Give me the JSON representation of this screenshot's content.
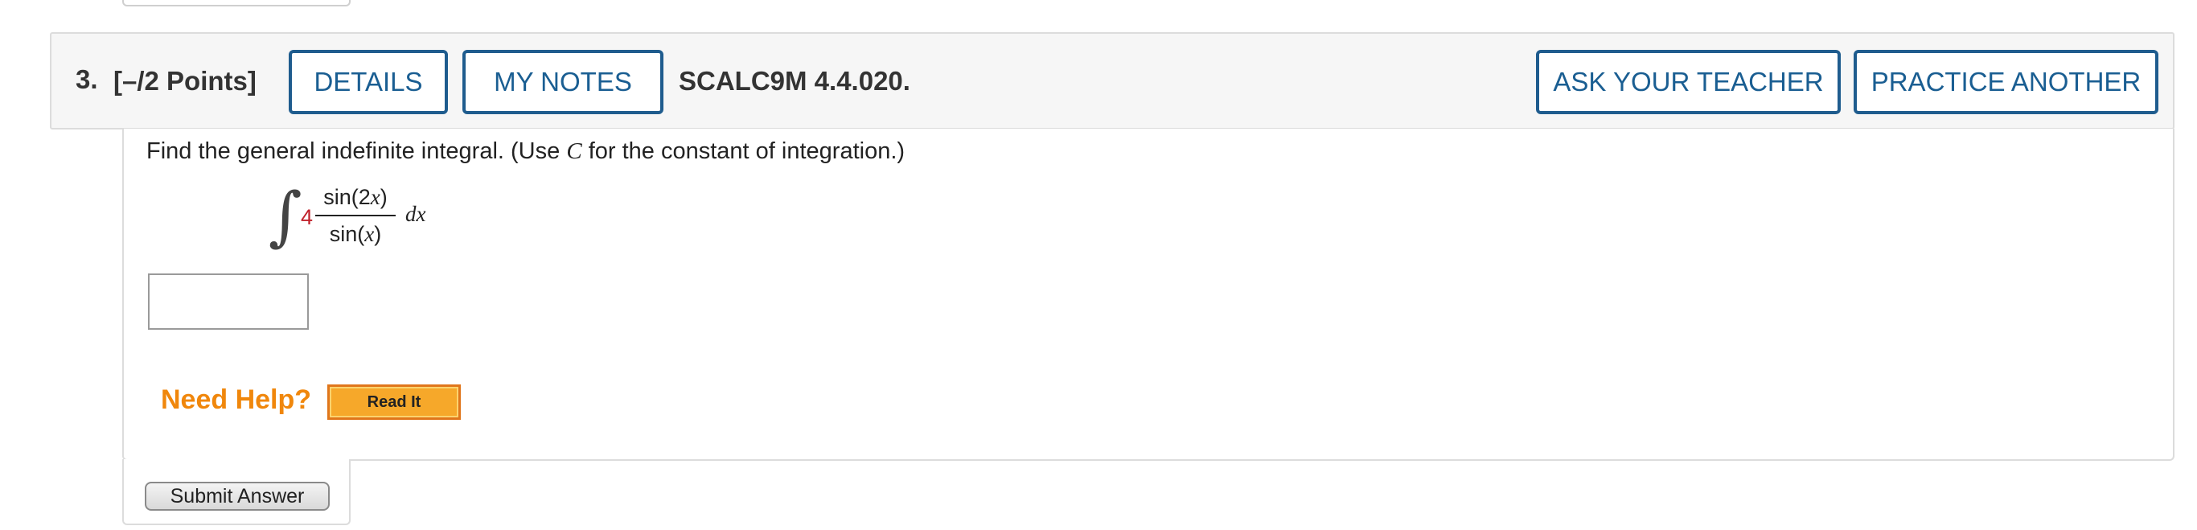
{
  "question": {
    "number": "3.",
    "points": "[–/2 Points]",
    "code": "SCALC9M 4.4.020.",
    "buttons": {
      "details": "DETAILS",
      "my_notes": "MY NOTES",
      "ask_teacher": "ASK YOUR TEACHER",
      "practice_another": "PRACTICE ANOTHER"
    },
    "prompt_before": "Find the general indefinite integral. (Use ",
    "prompt_var": "C",
    "prompt_after": " for the constant of integration.)",
    "integral": {
      "sign": "∫",
      "coefficient": "4",
      "numerator_fn": "sin(2",
      "numerator_var": "x",
      "numerator_close": ")",
      "denominator_fn": "sin(",
      "denominator_var": "x",
      "denominator_close": ")",
      "differential": "dx"
    },
    "answer_value": ""
  },
  "help": {
    "label": "Need Help?",
    "read_it": "Read It"
  },
  "submit": {
    "label": "Submit Answer"
  },
  "colors": {
    "button_text": "#1a5e92",
    "button_border": "#1f5c8e",
    "coefficient": "#c0202a",
    "need_help": "#f0870c",
    "read_it_bg": "#f6a82a"
  }
}
